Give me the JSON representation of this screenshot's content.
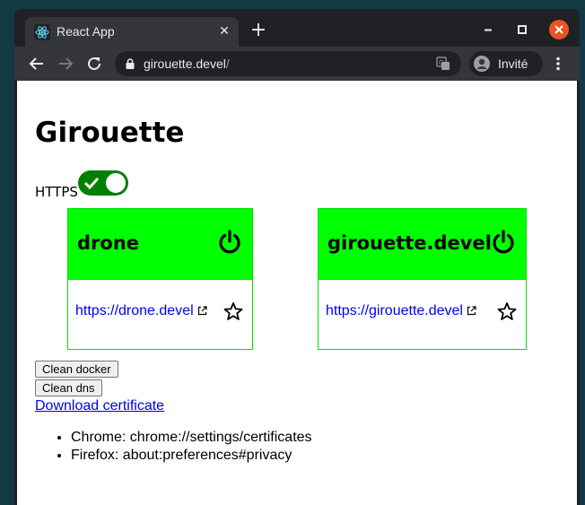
{
  "browser": {
    "tab_title": "React App",
    "url_host": "girouette.devel",
    "url_path": "/",
    "profile_label": "Invité"
  },
  "page": {
    "title": "Girouette",
    "https_label": "HTTPS",
    "https_enabled": true,
    "cards": [
      {
        "name": "drone",
        "link": "https://drone.devel"
      },
      {
        "name": "girouette.devel",
        "link": "https://girouette.devel"
      }
    ],
    "clean_docker_label": "Clean docker",
    "clean_dns_label": "Clean dns",
    "download_label": "Download certificate",
    "help_items": [
      "Chrome: chrome://settings/certificates",
      "Firefox: about:preferences#privacy"
    ]
  },
  "colors": {
    "card_header": "#00ff00",
    "toggle_on": "#008000",
    "link": "#0000ee"
  }
}
